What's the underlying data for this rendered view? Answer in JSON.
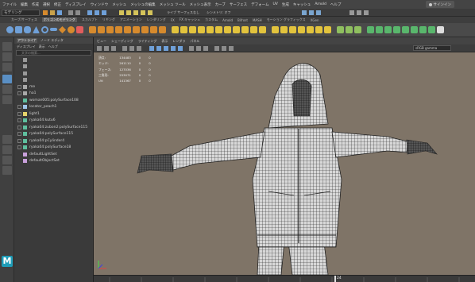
{
  "menubar": {
    "items": [
      "ファイル",
      "編集",
      "作成",
      "選択",
      "修正",
      "ディスプレイ",
      "ウィンドウ",
      "メッシュ",
      "メッシュの編集",
      "メッシュ ツール",
      "メッシュ表示",
      "カーブ",
      "サーフェス",
      "デフォーム",
      "UV",
      "生成",
      "キャッシュ",
      "Arnold",
      "ヘルプ"
    ],
    "signin": "サインイン"
  },
  "status_line": {
    "mode": "モデリング",
    "no_live": "ライブ サーフェスなし",
    "symmetry": "シンメトリ: オフ"
  },
  "shelf_tabs": [
    "カーブ/サーフェス",
    "ポリゴンのモデリング",
    "スカルプト",
    "リギング",
    "アニメーション",
    "レンダリング",
    "FX",
    "FX キャッシュ",
    "カスタム",
    "Arnold",
    "Bifrost",
    "MASH",
    "モーション グラフィックス",
    "XGen"
  ],
  "active_shelf_tab": "ポリゴンのモデリング",
  "outliner": {
    "tabs": [
      "アウトライナ",
      "ノード エディタ"
    ],
    "menu": [
      "ディスプレイ",
      "表示",
      "ヘルプ"
    ],
    "search_placeholder": "文字の検索...",
    "items": [
      "",
      "",
      "",
      "",
      "me",
      "ha1",
      "woman005:polySurface108",
      "locator_peach1",
      "light1",
      "ryaka04:kutu6",
      "ryaka04:zubon2:polySurface115",
      "ryaka04:polySurface115",
      "ryaka04:pCylinder4",
      "ryaka04:polySurface18",
      "defaultLightSet",
      "defaultObjectSet"
    ]
  },
  "viewport": {
    "menu": [
      "ビュー",
      "シェーディング",
      "ライティング",
      "表示",
      "レンダラ",
      "パネル"
    ],
    "colorspace": "sRGB gamma",
    "hud": [
      {
        "label": "頂点:",
        "a": "134483",
        "b": "0",
        "c": "0"
      },
      {
        "label": "エッジ:",
        "a": "261110",
        "b": "0",
        "c": "0"
      },
      {
        "label": "フェース:",
        "a": "127036",
        "b": "0",
        "c": "0"
      },
      {
        "label": "三角形:",
        "a": "253071",
        "b": "0",
        "c": "0"
      },
      {
        "label": "UV:",
        "a": "141367",
        "b": "0",
        "c": "0"
      }
    ]
  },
  "timeline": {
    "frame": "24"
  },
  "colors": {
    "viewport_bg": "#7f7467",
    "accent": "#5a8fc4",
    "maya_logo": "#1e9db8"
  }
}
